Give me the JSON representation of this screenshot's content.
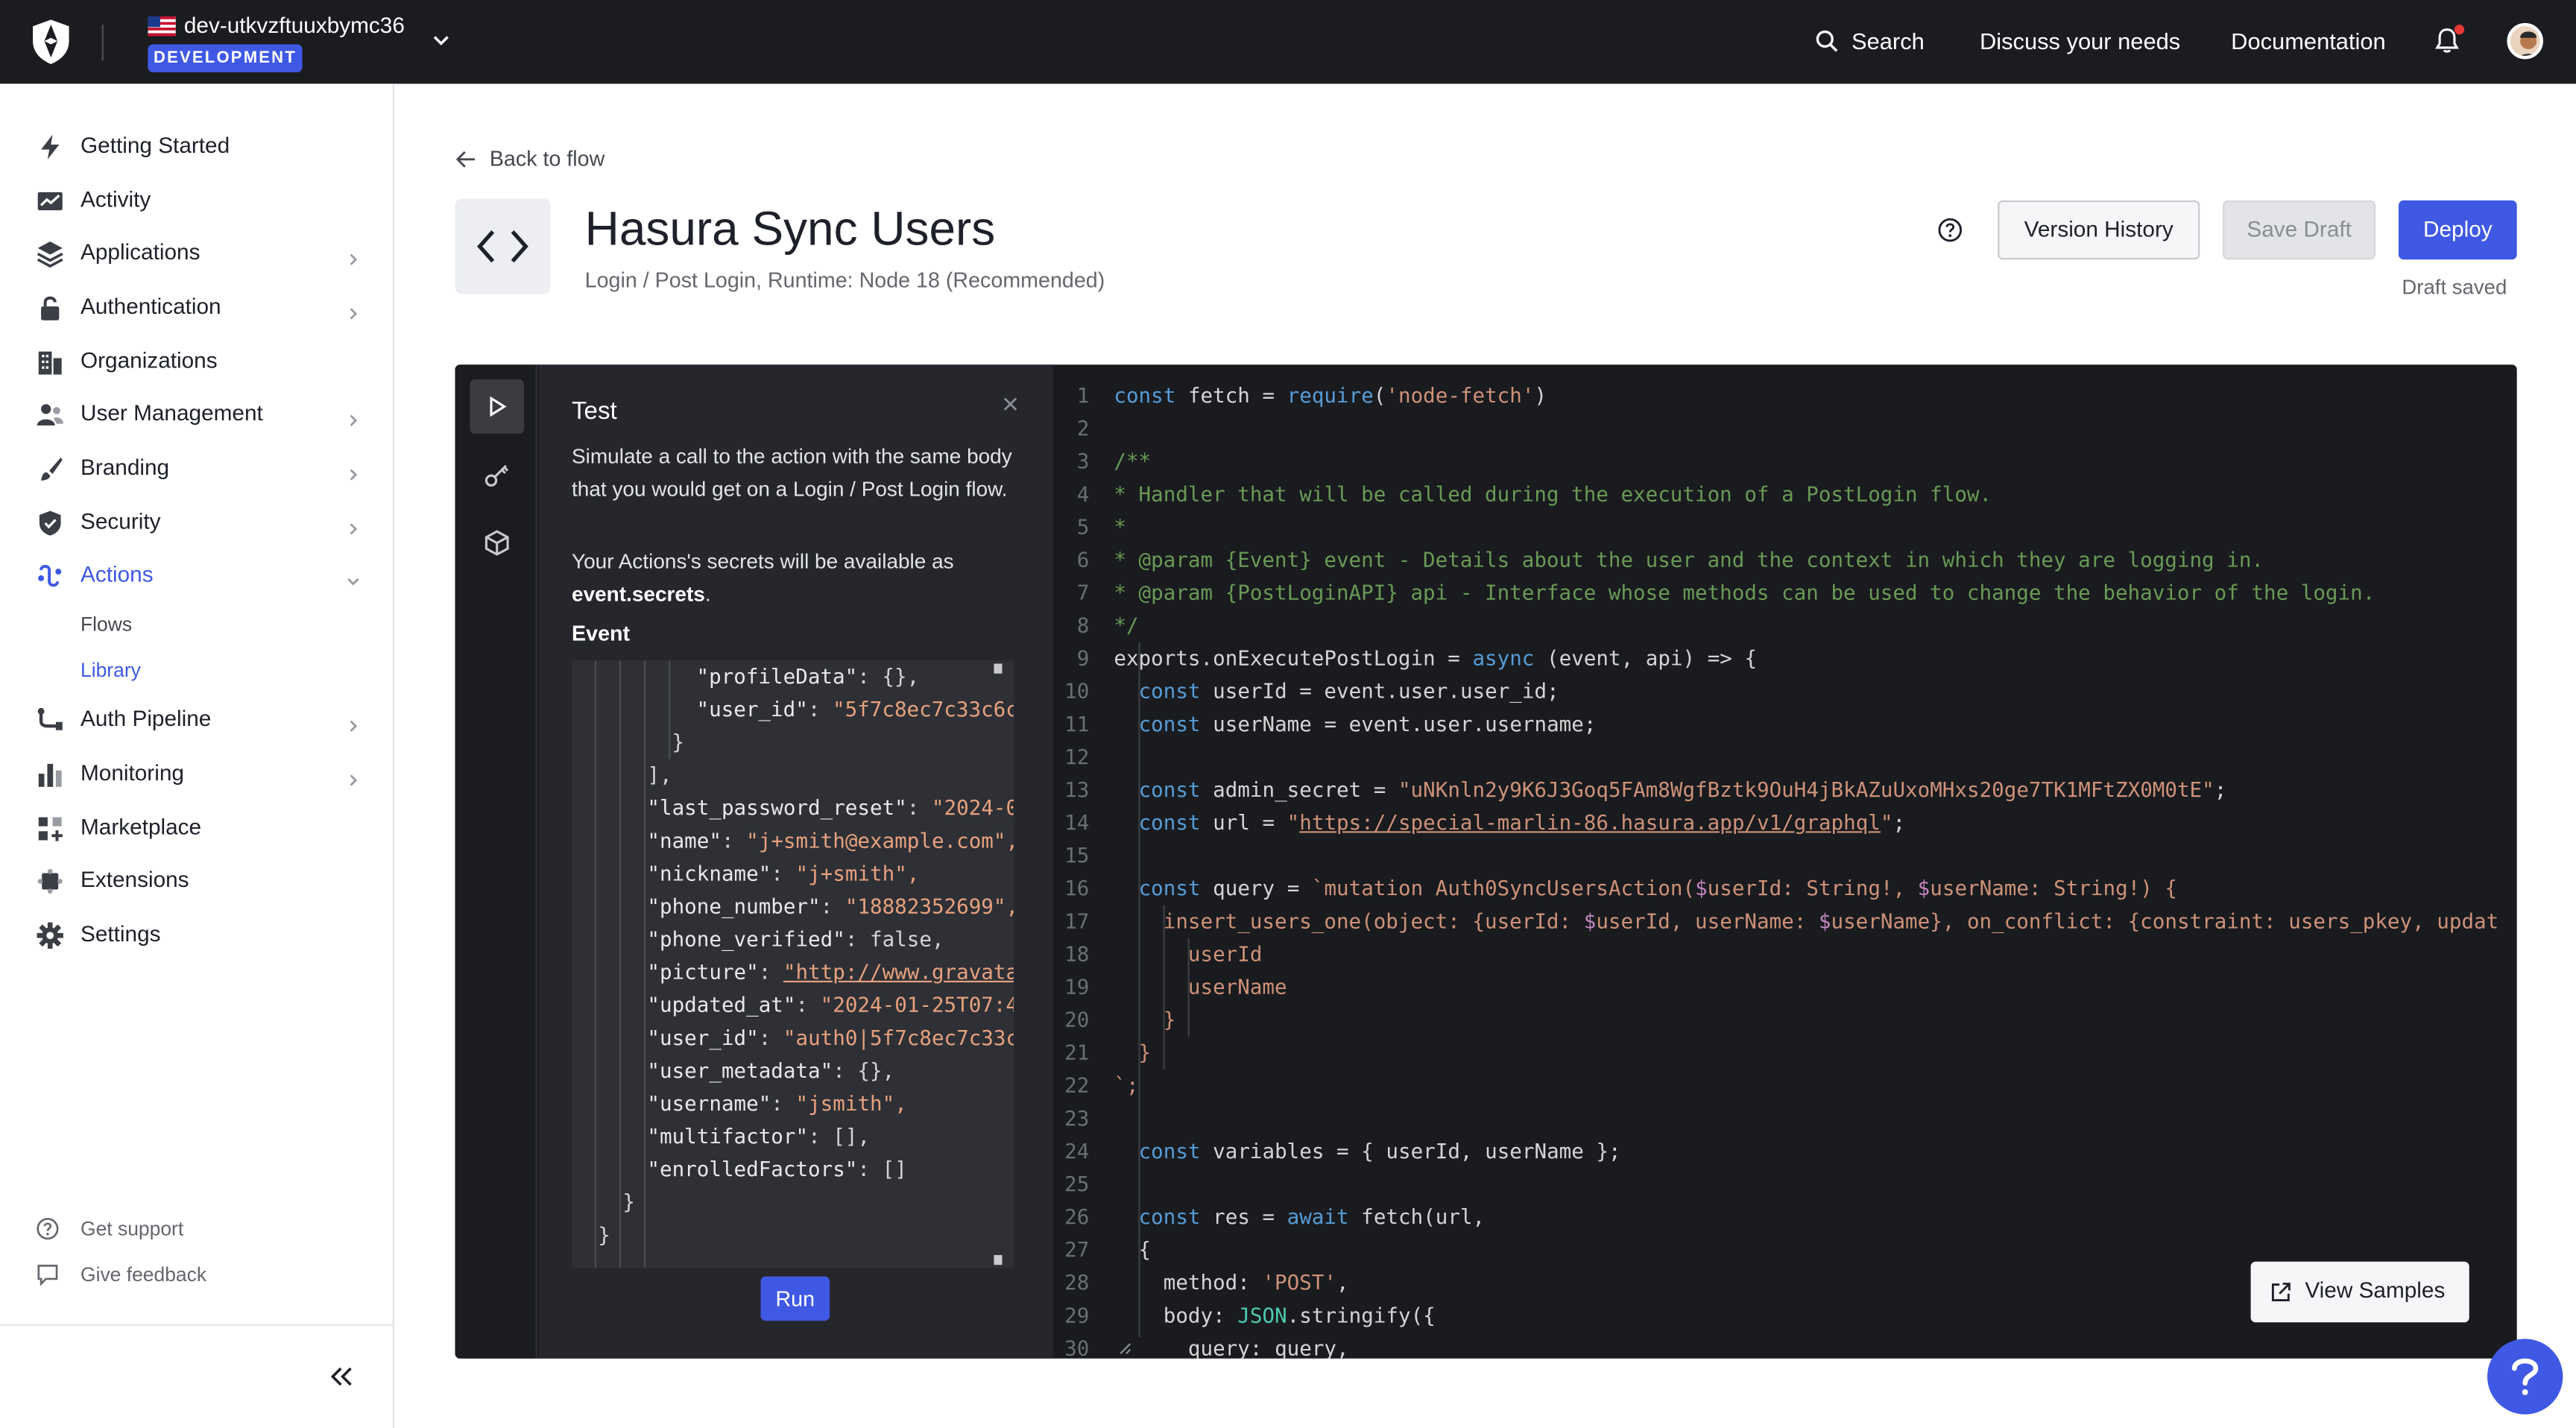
{
  "topbar": {
    "tenant_name": "dev-utkvzftuuxbymc36",
    "environment": "DEVELOPMENT",
    "search_label": "Search",
    "discuss_label": "Discuss your needs",
    "docs_label": "Documentation"
  },
  "sidebar": {
    "items": [
      {
        "label": "Getting Started",
        "icon": "bolt-icon"
      },
      {
        "label": "Activity",
        "icon": "chart-line-icon"
      },
      {
        "label": "Applications",
        "icon": "layers-icon"
      },
      {
        "label": "Authentication",
        "icon": "lock-icon"
      },
      {
        "label": "Organizations",
        "icon": "building-icon"
      },
      {
        "label": "User Management",
        "icon": "users-icon"
      },
      {
        "label": "Branding",
        "icon": "brush-icon"
      },
      {
        "label": "Security",
        "icon": "shield-icon"
      },
      {
        "label": "Actions",
        "icon": "actions-icon"
      },
      {
        "label": "Auth Pipeline",
        "icon": "pipeline-icon"
      },
      {
        "label": "Monitoring",
        "icon": "bar-chart-icon"
      },
      {
        "label": "Marketplace",
        "icon": "grid-plus-icon"
      },
      {
        "label": "Extensions",
        "icon": "puzzle-icon"
      },
      {
        "label": "Settings",
        "icon": "gear-icon"
      }
    ],
    "actions_sub": [
      "Flows",
      "Library"
    ],
    "get_support": "Get support",
    "give_feedback": "Give feedback"
  },
  "page": {
    "back_label": "Back to flow",
    "title": "Hasura Sync Users",
    "subtitle": "Login / Post Login, Runtime: Node 18 (Recommended)",
    "version_history": "Version History",
    "save_draft": "Save Draft",
    "deploy": "Deploy",
    "draft_status": "Draft saved"
  },
  "test_panel": {
    "title": "Test",
    "description": "Simulate a call to the action with the same body that you would get on a Login / Post Login flow.",
    "secrets_prefix": "Your Actions's secrets will be available as ",
    "secrets_code": "event.secrets",
    "secrets_suffix": ".",
    "event_label": "Event",
    "run_label": "Run",
    "json_lines": [
      {
        "indent": 76,
        "key": "\"profileData\"",
        "value": "{},",
        "vtype": "p"
      },
      {
        "indent": 76,
        "key": "\"user_id\"",
        "value": "\"5f7c8ec7c33c6c",
        "vtype": "v"
      },
      {
        "indent": 61,
        "key": "",
        "value": "}",
        "vtype": "p"
      },
      {
        "indent": 46,
        "key": "",
        "value": "],",
        "vtype": "p"
      },
      {
        "indent": 46,
        "key": "\"last_password_reset\"",
        "value": "\"2024-0",
        "vtype": "v"
      },
      {
        "indent": 46,
        "key": "\"name\"",
        "value": "\"j+smith@example.com\",",
        "vtype": "v"
      },
      {
        "indent": 46,
        "key": "\"nickname\"",
        "value": "\"j+smith\",",
        "vtype": "v"
      },
      {
        "indent": 46,
        "key": "\"phone_number\"",
        "value": "\"18882352699\",",
        "vtype": "v"
      },
      {
        "indent": 46,
        "key": "\"phone_verified\"",
        "value": "false,",
        "vtype": "p"
      },
      {
        "indent": 46,
        "key": "\"picture\"",
        "value": "\"http://www.gravata",
        "vtype": "u"
      },
      {
        "indent": 46,
        "key": "\"updated_at\"",
        "value": "\"2024-01-25T07:4",
        "vtype": "v"
      },
      {
        "indent": 46,
        "key": "\"user_id\"",
        "value": "\"auth0|5f7c8ec7c33c",
        "vtype": "v"
      },
      {
        "indent": 46,
        "key": "\"user_metadata\"",
        "value": "{},",
        "vtype": "p"
      },
      {
        "indent": 46,
        "key": "\"username\"",
        "value": "\"jsmith\",",
        "vtype": "v"
      },
      {
        "indent": 46,
        "key": "\"multifactor\"",
        "value": "[],",
        "vtype": "p"
      },
      {
        "indent": 46,
        "key": "\"enrolledFactors\"",
        "value": "[]",
        "vtype": "p"
      },
      {
        "indent": 31,
        "key": "",
        "value": "}",
        "vtype": "p"
      },
      {
        "indent": 16,
        "key": "",
        "value": "}",
        "vtype": "p"
      }
    ]
  },
  "code": {
    "lines": [
      "const fetch = require('node-fetch')",
      "",
      "/**",
      "* Handler that will be called during the execution of a PostLogin flow.",
      "*",
      "* @param {Event} event - Details about the user and the context in which they are logging in.",
      "* @param {PostLoginAPI} api - Interface whose methods can be used to change the behavior of the login.",
      "*/",
      "exports.onExecutePostLogin = async (event, api) => {",
      "  const userId = event.user.user_id;",
      "  const userName = event.user.username;",
      "",
      "  const admin_secret = \"uNKnln2y9K6J3Goq5FAm8WgfBztk9OuH4jBkAZuUxoMHxs20ge7TK1MFtZX0M0tE\";",
      "  const url = \"https://special-marlin-86.hasura.app/v1/graphql\";",
      "",
      "  const query = `mutation Auth0SyncUsersAction($userId: String!, $userName: String!) {",
      "    insert_users_one(object: {userId: $userId, userName: $userName}, on_conflict: {constraint: users_pkey, updat",
      "      userId",
      "      userName",
      "    }",
      "  }",
      "`;",
      "",
      "  const variables = { userId, userName };",
      "",
      "  const res = await fetch(url,",
      "  {",
      "    method: 'POST',",
      "    body: JSON.stringify({",
      "      query: query,"
    ],
    "view_samples": "View Samples"
  }
}
